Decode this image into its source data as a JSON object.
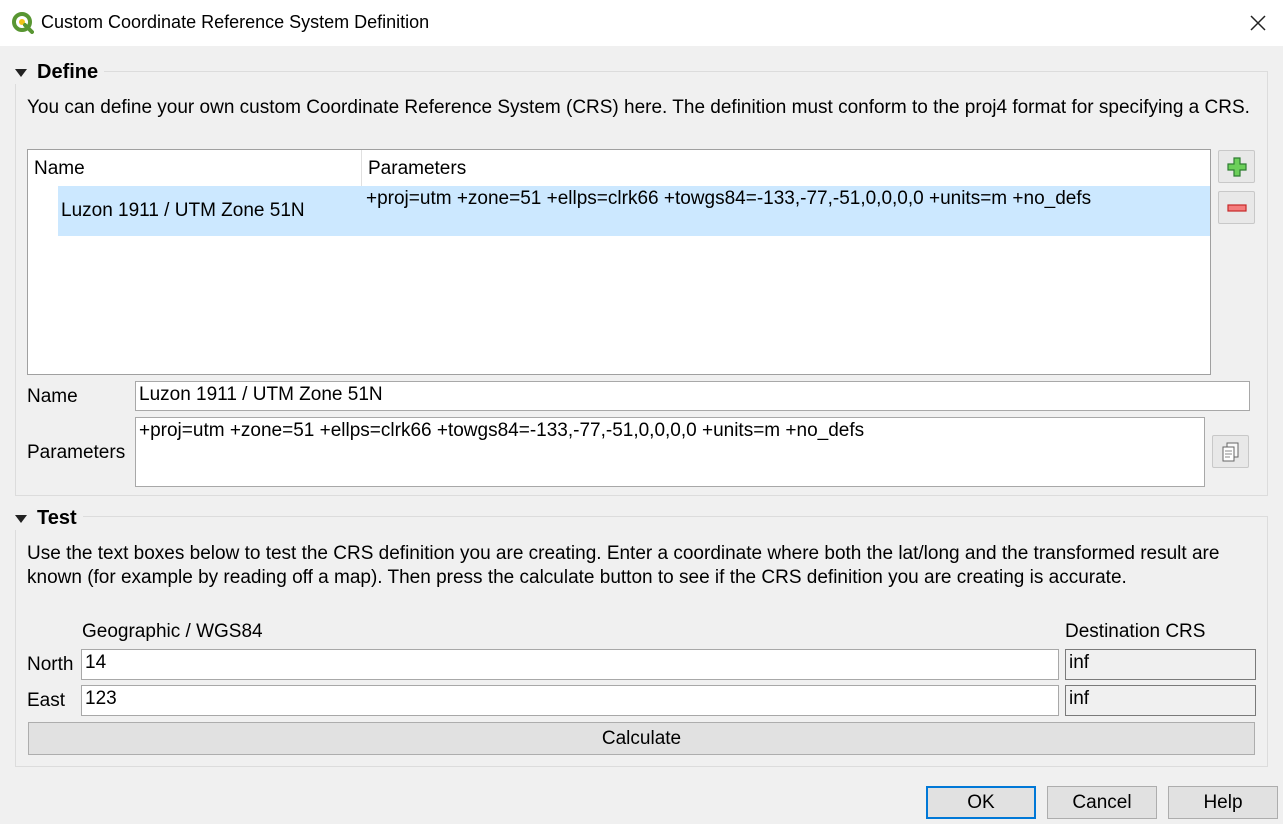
{
  "window": {
    "title": "Custom Coordinate Reference System Definition"
  },
  "define": {
    "header": "Define",
    "description": "You can define your own custom Coordinate Reference System (CRS) here. The definition must conform to the proj4 format for specifying a CRS.",
    "table": {
      "columns": [
        "Name",
        "Parameters"
      ],
      "rows": [
        {
          "name": "Luzon 1911 / UTM Zone 51N",
          "parameters": "+proj=utm +zone=51 +ellps=clrk66 +towgs84=-133,-77,-51,0,0,0,0 +units=m +no_defs"
        }
      ]
    },
    "name_label": "Name",
    "name_value": "Luzon 1911 / UTM Zone 51N",
    "parameters_label": "Parameters",
    "parameters_value": "+proj=utm +zone=51 +ellps=clrk66 +towgs84=-133,-77,-51,0,0,0,0 +units=m +no_defs"
  },
  "test": {
    "header": "Test",
    "description": "Use the text boxes below to test the CRS definition you are creating. Enter a coordinate where both the lat/long and the transformed result are known (for example by reading off a map). Then press the calculate button to see if the CRS definition you are creating is accurate.",
    "geo_header": "Geographic / WGS84",
    "dest_header": "Destination CRS",
    "north_label": "North",
    "east_label": "East",
    "north_value": "14",
    "east_value": "123",
    "north_dest": "inf",
    "east_dest": "inf",
    "calculate_label": "Calculate"
  },
  "buttons": {
    "ok": "OK",
    "cancel": "Cancel",
    "help": "Help"
  },
  "colors": {
    "selection": "#cce8ff",
    "qgis_green": "#589632",
    "add_green": "#4caf50",
    "remove_red": "#e53935",
    "default_button_border": "#0078d7"
  }
}
